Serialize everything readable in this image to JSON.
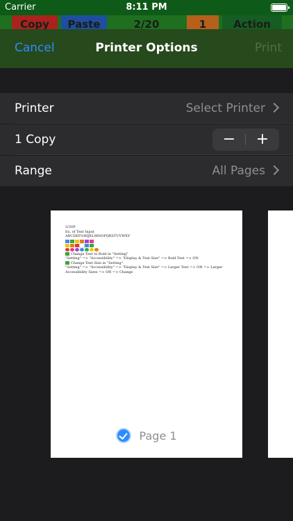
{
  "status_bar": {
    "carrier": "Carrier",
    "time": "8:11 PM"
  },
  "app_bar": {
    "buttons": [
      {
        "label": "Copy",
        "color": "#a8231e"
      },
      {
        "label": "Paste",
        "color": "#1d4f9e"
      },
      {
        "label": "2/20",
        "color": "#1e6f1f"
      },
      {
        "label": "1",
        "color": "#b5611c"
      },
      {
        "label": "Action",
        "color": "#155d22"
      }
    ]
  },
  "sheet": {
    "cancel": "Cancel",
    "title": "Printer Options",
    "print": "Print",
    "accent": "#2d8cff"
  },
  "options": {
    "printer": {
      "label": "Printer",
      "value": "Select Printer"
    },
    "copies": {
      "label": "1 Copy",
      "minus": "−",
      "plus": "+"
    },
    "range": {
      "label": "Range",
      "value": "All Pages"
    }
  },
  "preview": {
    "lines": {
      "l1": "2/20P",
      "l2": "Ex. of Text Input",
      "l3": "ABCDEFGHIJKLMNOPQRSTUVWXY",
      "l4": "Change Text to Bold in \"Setting\"",
      "l5": "\"Setting\" => \"Accessibility\" => \"Display & Text Size\" => Bold Text => ON",
      "l6": "Change Text Size in \"Setting\".",
      "l7": "\"Setting\" => \"Accessibility\" => \"Display & Text Size\" => Larger Text => ON => Larger Accessibility Sizes => ON => Change"
    },
    "hearts": [
      "#3b8de0",
      "#3aa537",
      "#f2c40f",
      "#e07f1b",
      "#a142d1",
      "#e23b8a"
    ],
    "blocks": [
      "#f2c40f",
      "#e07f1b",
      "#d93a2f",
      "#ffffff",
      "#3b8de0",
      "#3aa537"
    ],
    "dots": [
      "#d93a2f",
      "#e23b8a",
      "#a142d1",
      "#3b8de0",
      "#3aa537",
      "#f2c40f",
      "#e07f1b"
    ],
    "page_label": "Page 1"
  }
}
